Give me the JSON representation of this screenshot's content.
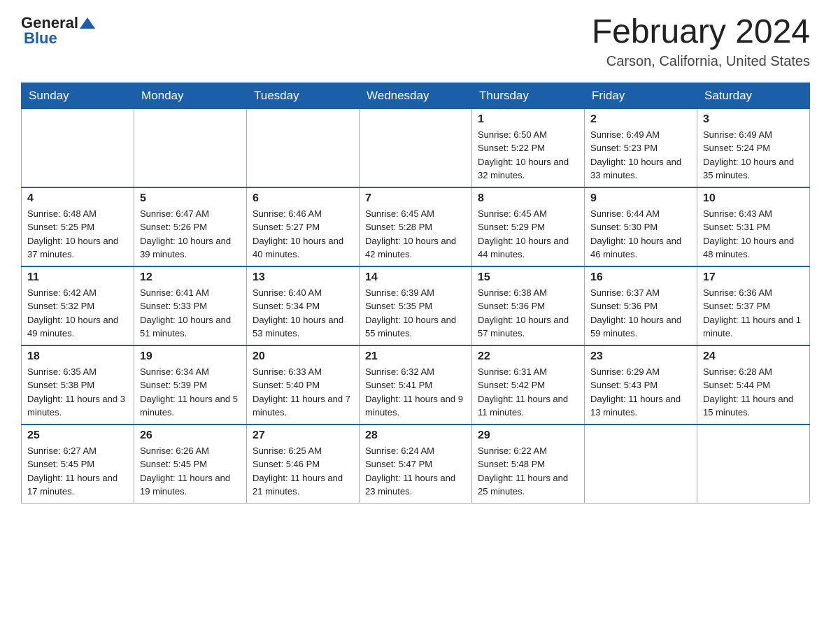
{
  "header": {
    "logo_general": "General",
    "logo_blue": "Blue",
    "title": "February 2024",
    "subtitle": "Carson, California, United States"
  },
  "days_of_week": [
    "Sunday",
    "Monday",
    "Tuesday",
    "Wednesday",
    "Thursday",
    "Friday",
    "Saturday"
  ],
  "weeks": [
    [
      {
        "day": "",
        "info": ""
      },
      {
        "day": "",
        "info": ""
      },
      {
        "day": "",
        "info": ""
      },
      {
        "day": "",
        "info": ""
      },
      {
        "day": "1",
        "info": "Sunrise: 6:50 AM\nSunset: 5:22 PM\nDaylight: 10 hours and 32 minutes."
      },
      {
        "day": "2",
        "info": "Sunrise: 6:49 AM\nSunset: 5:23 PM\nDaylight: 10 hours and 33 minutes."
      },
      {
        "day": "3",
        "info": "Sunrise: 6:49 AM\nSunset: 5:24 PM\nDaylight: 10 hours and 35 minutes."
      }
    ],
    [
      {
        "day": "4",
        "info": "Sunrise: 6:48 AM\nSunset: 5:25 PM\nDaylight: 10 hours and 37 minutes."
      },
      {
        "day": "5",
        "info": "Sunrise: 6:47 AM\nSunset: 5:26 PM\nDaylight: 10 hours and 39 minutes."
      },
      {
        "day": "6",
        "info": "Sunrise: 6:46 AM\nSunset: 5:27 PM\nDaylight: 10 hours and 40 minutes."
      },
      {
        "day": "7",
        "info": "Sunrise: 6:45 AM\nSunset: 5:28 PM\nDaylight: 10 hours and 42 minutes."
      },
      {
        "day": "8",
        "info": "Sunrise: 6:45 AM\nSunset: 5:29 PM\nDaylight: 10 hours and 44 minutes."
      },
      {
        "day": "9",
        "info": "Sunrise: 6:44 AM\nSunset: 5:30 PM\nDaylight: 10 hours and 46 minutes."
      },
      {
        "day": "10",
        "info": "Sunrise: 6:43 AM\nSunset: 5:31 PM\nDaylight: 10 hours and 48 minutes."
      }
    ],
    [
      {
        "day": "11",
        "info": "Sunrise: 6:42 AM\nSunset: 5:32 PM\nDaylight: 10 hours and 49 minutes."
      },
      {
        "day": "12",
        "info": "Sunrise: 6:41 AM\nSunset: 5:33 PM\nDaylight: 10 hours and 51 minutes."
      },
      {
        "day": "13",
        "info": "Sunrise: 6:40 AM\nSunset: 5:34 PM\nDaylight: 10 hours and 53 minutes."
      },
      {
        "day": "14",
        "info": "Sunrise: 6:39 AM\nSunset: 5:35 PM\nDaylight: 10 hours and 55 minutes."
      },
      {
        "day": "15",
        "info": "Sunrise: 6:38 AM\nSunset: 5:36 PM\nDaylight: 10 hours and 57 minutes."
      },
      {
        "day": "16",
        "info": "Sunrise: 6:37 AM\nSunset: 5:36 PM\nDaylight: 10 hours and 59 minutes."
      },
      {
        "day": "17",
        "info": "Sunrise: 6:36 AM\nSunset: 5:37 PM\nDaylight: 11 hours and 1 minute."
      }
    ],
    [
      {
        "day": "18",
        "info": "Sunrise: 6:35 AM\nSunset: 5:38 PM\nDaylight: 11 hours and 3 minutes."
      },
      {
        "day": "19",
        "info": "Sunrise: 6:34 AM\nSunset: 5:39 PM\nDaylight: 11 hours and 5 minutes."
      },
      {
        "day": "20",
        "info": "Sunrise: 6:33 AM\nSunset: 5:40 PM\nDaylight: 11 hours and 7 minutes."
      },
      {
        "day": "21",
        "info": "Sunrise: 6:32 AM\nSunset: 5:41 PM\nDaylight: 11 hours and 9 minutes."
      },
      {
        "day": "22",
        "info": "Sunrise: 6:31 AM\nSunset: 5:42 PM\nDaylight: 11 hours and 11 minutes."
      },
      {
        "day": "23",
        "info": "Sunrise: 6:29 AM\nSunset: 5:43 PM\nDaylight: 11 hours and 13 minutes."
      },
      {
        "day": "24",
        "info": "Sunrise: 6:28 AM\nSunset: 5:44 PM\nDaylight: 11 hours and 15 minutes."
      }
    ],
    [
      {
        "day": "25",
        "info": "Sunrise: 6:27 AM\nSunset: 5:45 PM\nDaylight: 11 hours and 17 minutes."
      },
      {
        "day": "26",
        "info": "Sunrise: 6:26 AM\nSunset: 5:45 PM\nDaylight: 11 hours and 19 minutes."
      },
      {
        "day": "27",
        "info": "Sunrise: 6:25 AM\nSunset: 5:46 PM\nDaylight: 11 hours and 21 minutes."
      },
      {
        "day": "28",
        "info": "Sunrise: 6:24 AM\nSunset: 5:47 PM\nDaylight: 11 hours and 23 minutes."
      },
      {
        "day": "29",
        "info": "Sunrise: 6:22 AM\nSunset: 5:48 PM\nDaylight: 11 hours and 25 minutes."
      },
      {
        "day": "",
        "info": ""
      },
      {
        "day": "",
        "info": ""
      }
    ]
  ]
}
